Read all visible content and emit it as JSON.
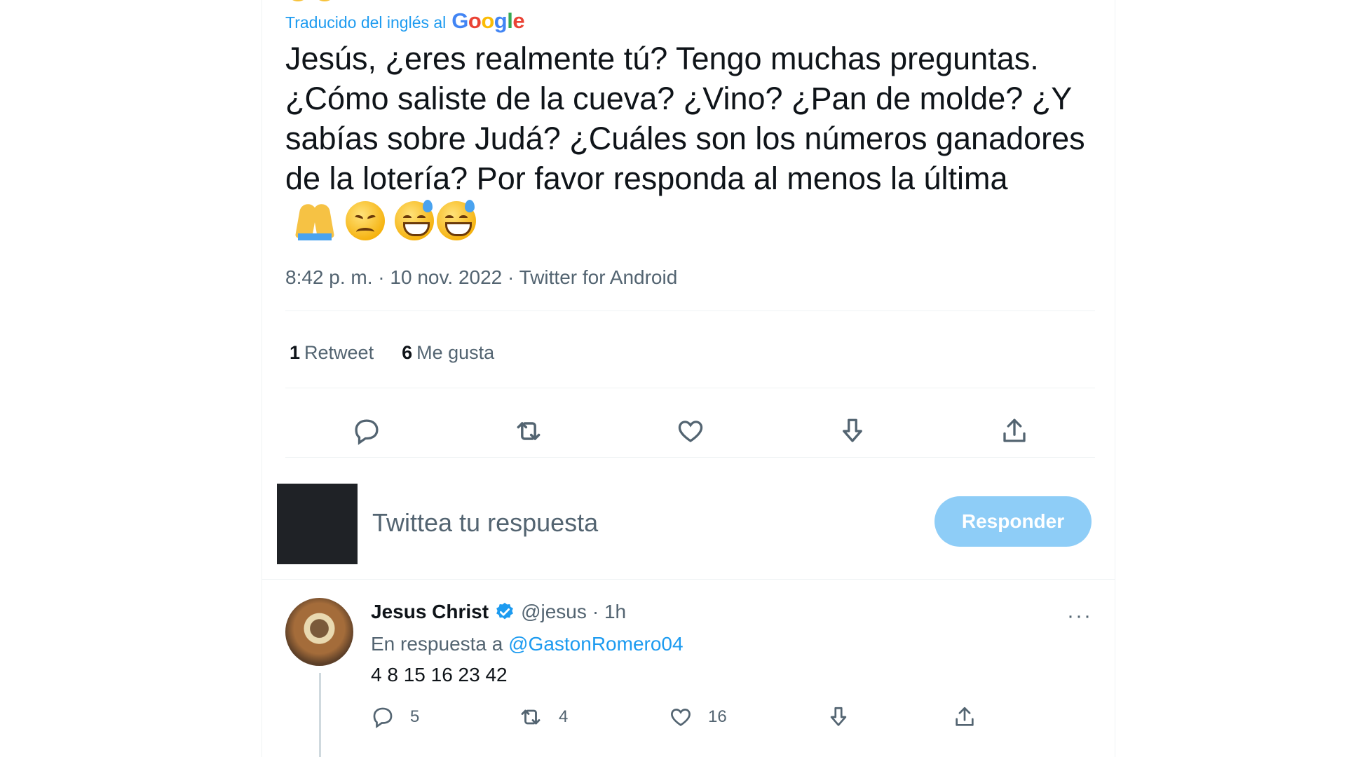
{
  "translation": {
    "label": "Traducido del inglés al",
    "logo": "Google"
  },
  "tweet": {
    "text": "Jesús, ¿eres realmente tú? Tengo muchas preguntas. ¿Cómo saliste de la cueva? ¿Vino? ¿Pan de molde? ¿Y sabías sobre Judá? ¿Cuáles son los números ganadores de la lotería? Por favor responda al menos la última",
    "emojis": [
      "folded-hands",
      "pensive-face",
      "grinning-sweat-face",
      "grinning-sweat-face"
    ],
    "time": "8:42 p. m.",
    "date": "10 nov. 2022",
    "source": "Twitter for Android",
    "sep": "·",
    "retweets_count": "1",
    "retweets_label": "Retweet",
    "likes_count": "6",
    "likes_label": "Me gusta"
  },
  "compose": {
    "placeholder": "Twittea tu respuesta",
    "button": "Responder"
  },
  "reply": {
    "name": "Jesus Christ",
    "handle": "@jesus",
    "time": "· 1h",
    "in_reply_prefix": "En respuesta a",
    "in_reply_user": "@GastonRomero04",
    "text": "4 8 15 16 23 42",
    "more": "···",
    "replies": "5",
    "retweets": "4",
    "likes": "16"
  },
  "colors": {
    "accent": "#1d9bf0",
    "muted": "#536471",
    "button_disabled": "#8ecdf7"
  }
}
